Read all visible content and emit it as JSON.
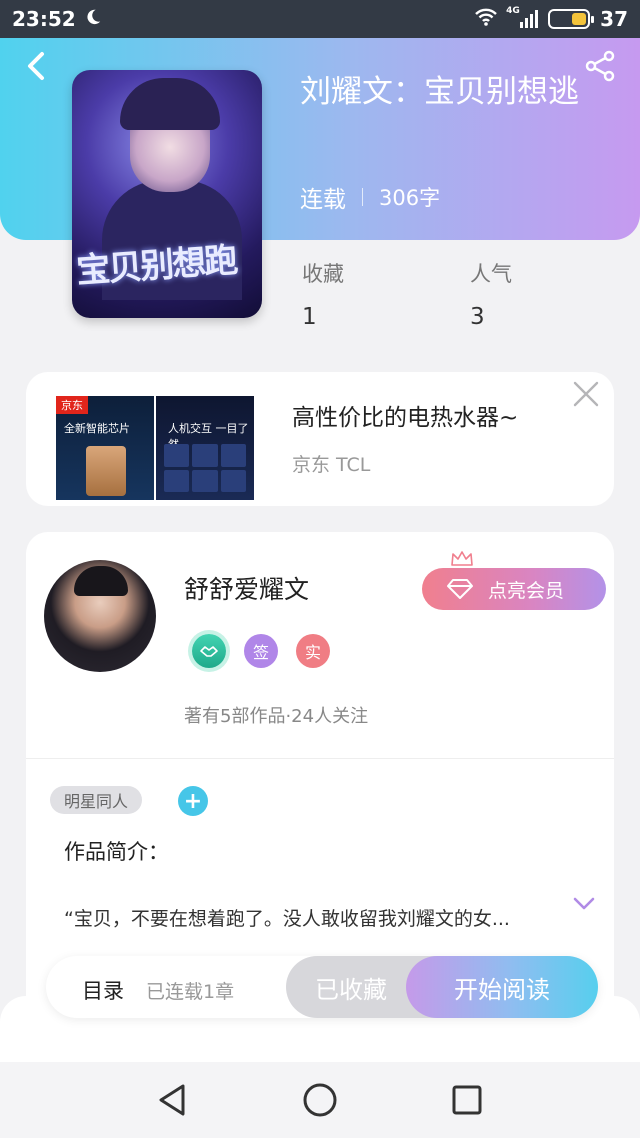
{
  "status_bar": {
    "time": "23:52",
    "network": "4G",
    "battery": "37"
  },
  "book": {
    "title": "刘耀文：宝贝别想逃",
    "status": "连载",
    "word_count": "306字",
    "cover_text": "宝贝别想跑"
  },
  "stats": [
    {
      "label": "收藏",
      "value": "1"
    },
    {
      "label": "人气",
      "value": "3"
    }
  ],
  "ad": {
    "title": "高性价比的电热水器~",
    "source": "京东 TCL",
    "brand_tag": "京东",
    "image_text_left": "全新智能芯片",
    "image_text_right": "人机交互 一目了然"
  },
  "author": {
    "name": "舒舒爱耀文",
    "vip_label": "点亮会员",
    "badge_sign": "签",
    "badge_real": "实",
    "stats": "著有5部作品·24人关注"
  },
  "tags": [
    "明星同人"
  ],
  "tag_add": "+",
  "intro": {
    "title": "作品简介：",
    "text": "“宝贝，不要在想着跑了。没人敢收留我刘耀文的女..."
  },
  "action_bar": {
    "toc_label": "目录",
    "toc_count": "已连载1章",
    "fav_label": "已收藏",
    "read_label": "开始阅读"
  },
  "colors": {
    "header_gradient": [
      "#50d2ee",
      "#c69af0"
    ],
    "vip_gradient": [
      "#f07f8e",
      "#b392e8"
    ],
    "read_gradient": [
      "#c59ae9",
      "#57cfee"
    ],
    "tag_add": "#46c6e8"
  },
  "icons": [
    "moon-icon",
    "wifi-icon",
    "signal-icon",
    "battery-icon",
    "back-icon",
    "share-icon",
    "close-icon",
    "diamond-icon",
    "crown-icon",
    "chevron-down-icon",
    "nav-back-icon",
    "nav-home-icon",
    "nav-recents-icon"
  ]
}
